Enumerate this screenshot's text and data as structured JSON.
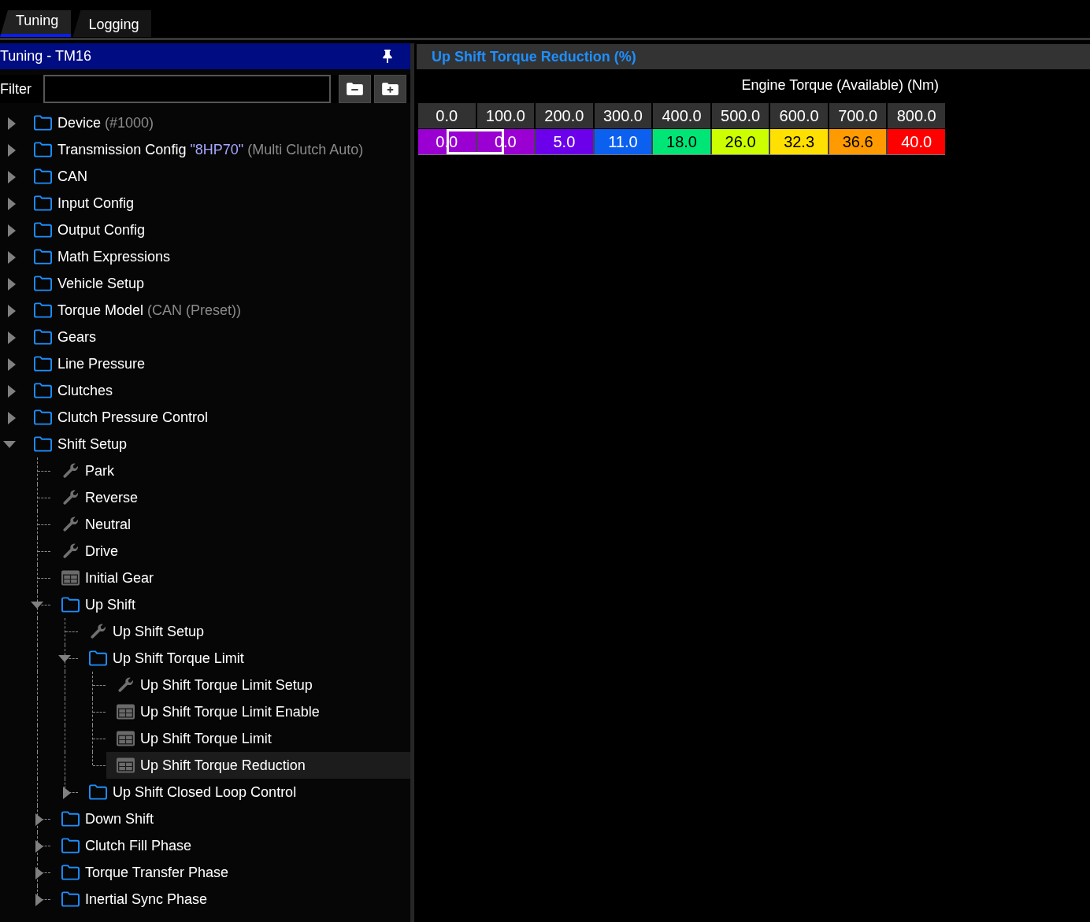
{
  "tabs": [
    {
      "label": "Tuning",
      "selected": true
    },
    {
      "label": "Logging",
      "selected": false
    }
  ],
  "sidebar": {
    "title": "Tuning - TM16",
    "filter": {
      "label": "Filter"
    },
    "tree": [
      {
        "label": "Device",
        "note": "(#1000)",
        "kind": "folder",
        "expanded": false,
        "selected": false
      },
      {
        "label": "Transmission Config",
        "value": "\"8HP70\"",
        "note": "(Multi Clutch Auto)",
        "kind": "folder",
        "expanded": false,
        "selected": false
      },
      {
        "label": "CAN",
        "kind": "folder",
        "expanded": false,
        "selected": false
      },
      {
        "label": "Input Config",
        "kind": "folder",
        "expanded": false,
        "selected": false
      },
      {
        "label": "Output Config",
        "kind": "folder",
        "expanded": false,
        "selected": false
      },
      {
        "label": "Math Expressions",
        "kind": "folder",
        "expanded": false,
        "selected": false
      },
      {
        "label": "Vehicle Setup",
        "kind": "folder",
        "expanded": false,
        "selected": false
      },
      {
        "label": "Torque Model",
        "note": "(CAN (Preset))",
        "kind": "folder",
        "expanded": false,
        "selected": false
      },
      {
        "label": "Gears",
        "kind": "folder",
        "expanded": false,
        "selected": false
      },
      {
        "label": "Line Pressure",
        "kind": "folder",
        "expanded": false,
        "selected": false
      },
      {
        "label": "Clutches",
        "kind": "folder",
        "expanded": false,
        "selected": false
      },
      {
        "label": "Clutch Pressure Control",
        "kind": "folder",
        "expanded": false,
        "selected": false
      },
      {
        "label": "Shift Setup",
        "kind": "folder",
        "expanded": true,
        "selected": false,
        "children": [
          {
            "label": "Park",
            "kind": "settings",
            "selected": false
          },
          {
            "label": "Reverse",
            "kind": "settings",
            "selected": false
          },
          {
            "label": "Neutral",
            "kind": "settings",
            "selected": false
          },
          {
            "label": "Drive",
            "kind": "settings",
            "selected": false
          },
          {
            "label": "Initial Gear",
            "kind": "table",
            "selected": false
          },
          {
            "label": "Up Shift",
            "kind": "folder",
            "expanded": true,
            "selected": false,
            "children": [
              {
                "label": "Up Shift Setup",
                "kind": "settings",
                "selected": false
              },
              {
                "label": "Up Shift Torque Limit",
                "kind": "folder",
                "expanded": true,
                "selected": false,
                "children": [
                  {
                    "label": "Up Shift Torque Limit Setup",
                    "kind": "settings",
                    "selected": false
                  },
                  {
                    "label": "Up Shift Torque Limit Enable",
                    "kind": "table",
                    "selected": false
                  },
                  {
                    "label": "Up Shift Torque Limit",
                    "kind": "table",
                    "selected": false
                  },
                  {
                    "label": "Up Shift Torque Reduction",
                    "kind": "table",
                    "selected": true
                  }
                ]
              },
              {
                "label": "Up Shift Closed Loop Control",
                "kind": "folder",
                "expanded": false,
                "selected": false
              }
            ]
          },
          {
            "label": "Down Shift",
            "kind": "folder",
            "expanded": false,
            "selected": false
          },
          {
            "label": "Clutch Fill Phase",
            "kind": "folder",
            "expanded": false,
            "selected": false
          },
          {
            "label": "Torque Transfer Phase",
            "kind": "folder",
            "expanded": false,
            "selected": false
          },
          {
            "label": "Inertial Sync Phase",
            "kind": "folder",
            "expanded": false,
            "selected": false
          }
        ]
      }
    ]
  },
  "editor": {
    "title": "Up Shift Torque Reduction (%)",
    "axis_label": "Engine Torque (Available) (Nm)",
    "columns": [
      "0.0",
      "100.0",
      "200.0",
      "300.0",
      "400.0",
      "500.0",
      "600.0",
      "700.0",
      "800.0"
    ],
    "cells": [
      {
        "value": "0.0",
        "color": "#9a00d2",
        "selected": true
      },
      {
        "value": "0.0",
        "color": "#9a00d2",
        "selected": false
      },
      {
        "value": "5.0",
        "color": "#6c00ea",
        "selected": false
      },
      {
        "value": "11.0",
        "color": "#0b60f0",
        "selected": false
      },
      {
        "value": "18.0",
        "color": "#00e676",
        "selected": false
      },
      {
        "value": "26.0",
        "color": "#ccff00",
        "selected": false
      },
      {
        "value": "32.3",
        "color": "#ffe000",
        "selected": false
      },
      {
        "value": "36.6",
        "color": "#ff9a00",
        "selected": false
      },
      {
        "value": "40.0",
        "color": "#ff0000",
        "selected": false
      }
    ]
  }
}
